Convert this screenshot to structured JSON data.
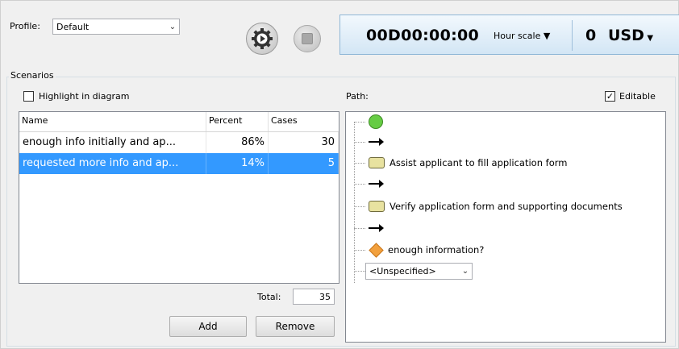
{
  "profile": {
    "label": "Profile:",
    "value": "Default"
  },
  "timer": {
    "time": "00D00:00:00",
    "scale": "Hour scale",
    "cost": "0",
    "currency": "USD"
  },
  "scenarios": {
    "group_title": "Scenarios",
    "highlight_label": "Highlight in diagram",
    "highlight_checked": false,
    "columns": [
      "Name",
      "Percent",
      "Cases"
    ],
    "rows": [
      {
        "name": "enough info initially and ap...",
        "percent": "86%",
        "cases": "30"
      },
      {
        "name": "requested more info and ap...",
        "percent": "14%",
        "cases": "5"
      }
    ],
    "selected_row": 1,
    "total_label": "Total:",
    "total_value": "35",
    "add_label": "Add",
    "remove_label": "Remove"
  },
  "path": {
    "label": "Path:",
    "editable_label": "Editable",
    "editable_checked": true,
    "items": [
      {
        "kind": "start"
      },
      {
        "kind": "flow"
      },
      {
        "kind": "activity",
        "label": "Assist applicant to fill application form"
      },
      {
        "kind": "flow"
      },
      {
        "kind": "activity",
        "label": "Verify application form and supporting documents"
      },
      {
        "kind": "flow"
      },
      {
        "kind": "gateway",
        "label": "enough information?"
      }
    ],
    "gateway_choice": "<Unspecified>"
  },
  "colors": {
    "selection": "#3399ff",
    "timer_bg": "#d3e6f5",
    "start_node": "#66cc44",
    "activity": "#e8e2a0",
    "gateway": "#f2a03d"
  }
}
